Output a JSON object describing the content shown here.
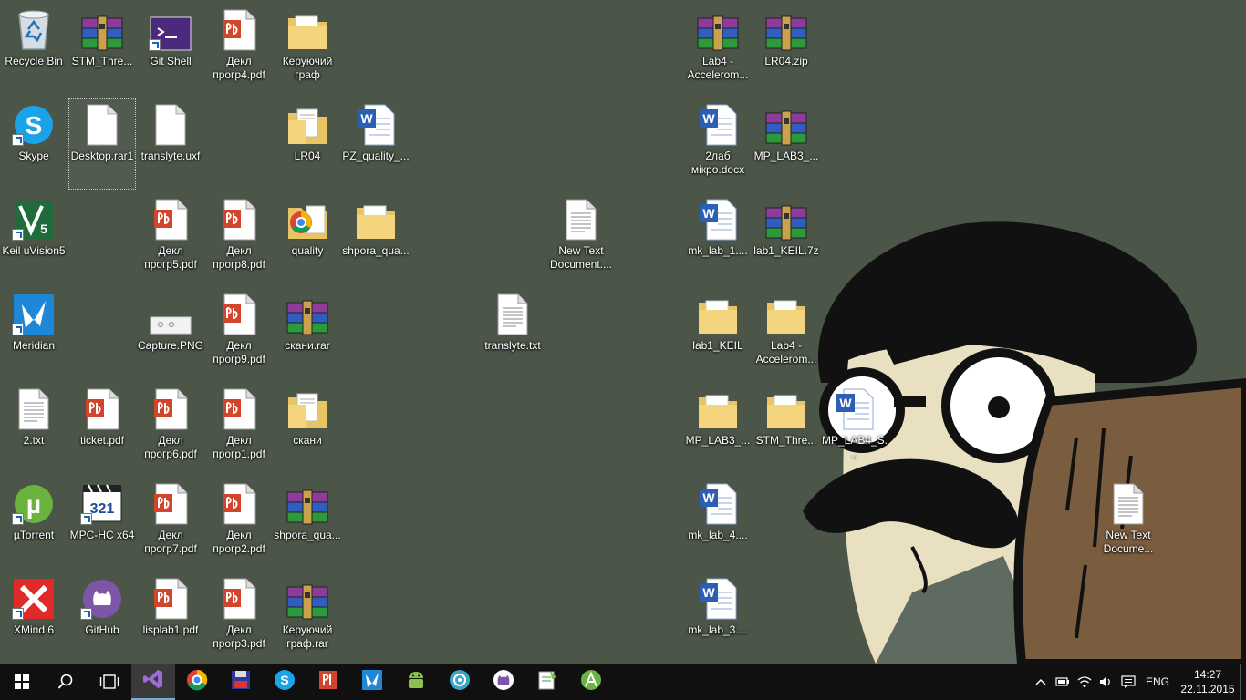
{
  "desktop": {
    "icons": [
      {
        "label": "Recycle Bin",
        "type": "recycle"
      },
      {
        "label": "STM_Thre...",
        "type": "rar"
      },
      {
        "label": "Git Shell",
        "type": "gitshell",
        "shortcut": true
      },
      {
        "label": "Декл прогр4.pdf",
        "type": "pdf"
      },
      {
        "label": "Керуючий граф",
        "type": "folder"
      },
      {
        "label": "Lab4 - Accelerom...",
        "type": "rar"
      },
      {
        "label": "LR04.zip",
        "type": "rar"
      },
      {
        "label": "Skype",
        "type": "skype",
        "shortcut": true
      },
      {
        "label": "Desktop.rar1",
        "type": "blank",
        "selected": true
      },
      {
        "label": "translyte.uxf",
        "type": "blank"
      },
      {
        "label": "LR04",
        "type": "folderdoc"
      },
      {
        "label": "PZ_quality_...",
        "type": "word"
      },
      {
        "label": "2лаб мікро.docx",
        "type": "word"
      },
      {
        "label": "MP_LAB3_...",
        "type": "rar"
      },
      {
        "label": "Keil uVision5",
        "type": "keil",
        "shortcut": true
      },
      {
        "label": "Декл прогр5.pdf",
        "type": "pdf"
      },
      {
        "label": "Декл прогр8.pdf",
        "type": "pdf"
      },
      {
        "label": "quality",
        "type": "folderchrome"
      },
      {
        "label": "shpora_qua...",
        "type": "folder"
      },
      {
        "label": "New Text Document....",
        "type": "txt"
      },
      {
        "label": "mk_lab_1....",
        "type": "word"
      },
      {
        "label": "lab1_KEIL.7z",
        "type": "rar"
      },
      {
        "label": "Meridian",
        "type": "meridian",
        "shortcut": true
      },
      {
        "label": "Capture.PNG",
        "type": "png"
      },
      {
        "label": "Декл прогр9.pdf",
        "type": "pdf"
      },
      {
        "label": "скани.rar",
        "type": "rar"
      },
      {
        "label": "translyte.txt",
        "type": "txt"
      },
      {
        "label": "lab1_KEIL",
        "type": "folder"
      },
      {
        "label": "Lab4 - Accelerom...",
        "type": "folder"
      },
      {
        "label": "2.txt",
        "type": "txt"
      },
      {
        "label": "ticket.pdf",
        "type": "pdf"
      },
      {
        "label": "Декл прогр6.pdf",
        "type": "pdf"
      },
      {
        "label": "Декл прогр1.pdf",
        "type": "pdf"
      },
      {
        "label": "скани",
        "type": "folderdoc"
      },
      {
        "label": "MP_LAB3_...",
        "type": "folder"
      },
      {
        "label": "STM_Thre...",
        "type": "folder"
      },
      {
        "label": "MP_LAB4_S...",
        "type": "word"
      },
      {
        "label": "µTorrent",
        "type": "utorrent",
        "shortcut": true
      },
      {
        "label": "MPC-HC x64",
        "type": "mpc",
        "shortcut": true
      },
      {
        "label": "Декл прогр7.pdf",
        "type": "pdf"
      },
      {
        "label": "Декл прогр2.pdf",
        "type": "pdf"
      },
      {
        "label": "shpora_qua...",
        "type": "rar"
      },
      {
        "label": "mk_lab_4....",
        "type": "word"
      },
      {
        "label": "New Text Docume...",
        "type": "txt"
      },
      {
        "label": "XMind 6",
        "type": "xmind",
        "shortcut": true
      },
      {
        "label": "GitHub",
        "type": "github",
        "shortcut": true
      },
      {
        "label": "lisplab1.pdf",
        "type": "pdf"
      },
      {
        "label": "Декл прогр3.pdf",
        "type": "pdf"
      },
      {
        "label": "Керуючий граф.rar",
        "type": "rar"
      },
      {
        "label": "mk_lab_3....",
        "type": "word"
      }
    ]
  },
  "taskbar": {
    "start": "start-icon",
    "search": "search-icon",
    "taskview": "task-view-icon",
    "pinned": [
      {
        "name": "visual-studio-icon",
        "active": true
      },
      {
        "name": "chrome-icon",
        "active": false
      },
      {
        "name": "floppy-app-icon",
        "active": false
      },
      {
        "name": "skype-icon",
        "active": false
      },
      {
        "name": "pdf-reader-icon",
        "active": false
      },
      {
        "name": "meridian-icon",
        "active": false
      },
      {
        "name": "android-icon",
        "active": false
      },
      {
        "name": "network-app-icon",
        "active": false
      },
      {
        "name": "github-icon",
        "active": false
      },
      {
        "name": "notepad-plus-icon",
        "active": false
      },
      {
        "name": "android-studio-icon",
        "active": false
      }
    ],
    "tray": {
      "lang": "ENG",
      "time": "14:27",
      "date": "22.11.2015"
    }
  },
  "colors": {
    "desktop_bg": "#4b5548",
    "taskbar_bg": "#101010",
    "accent": "#7ba7d6"
  }
}
